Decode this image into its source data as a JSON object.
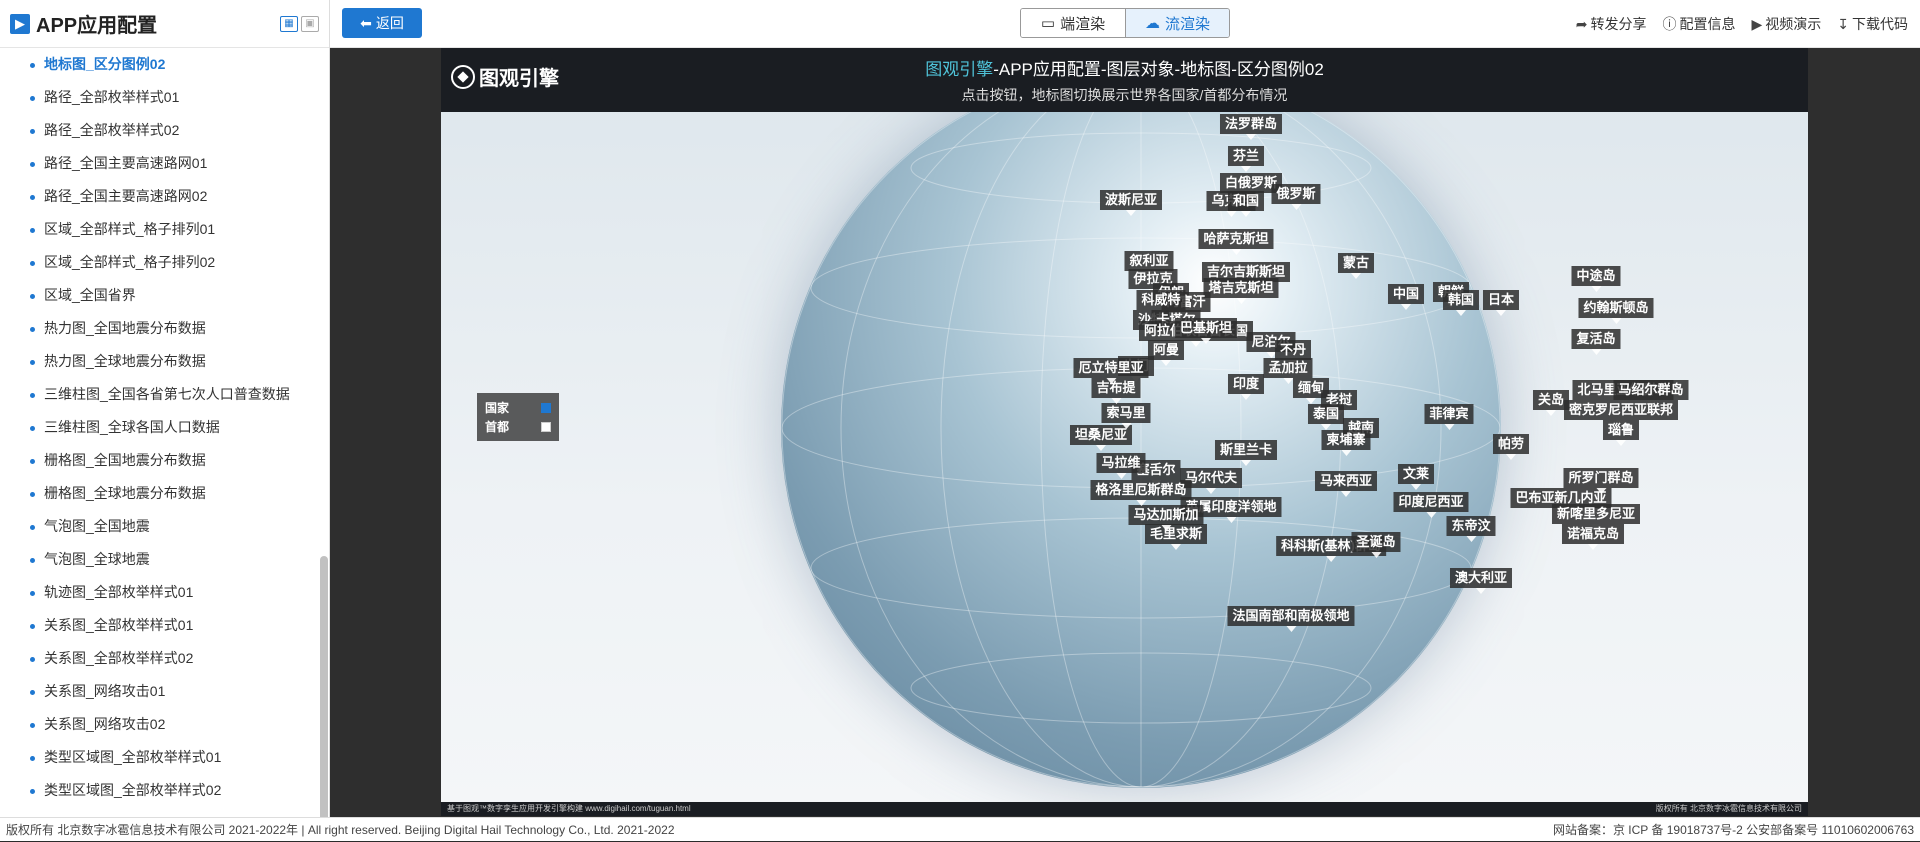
{
  "sidebar": {
    "title": "APP应用配置",
    "icon": "app-config-icon",
    "items": [
      "地标图_区分图例02",
      "路径_全部枚举样式01",
      "路径_全部枚举样式02",
      "路径_全国主要高速路网01",
      "路径_全国主要高速路网02",
      "区域_全部样式_格子排列01",
      "区域_全部样式_格子排列02",
      "区域_全国省界",
      "热力图_全国地震分布数据",
      "热力图_全球地震分布数据",
      "三维柱图_全国各省第七次人口普查数据",
      "三维柱图_全球各国人口数据",
      "栅格图_全国地震分布数据",
      "栅格图_全球地震分布数据",
      "气泡图_全国地震",
      "气泡图_全球地震",
      "轨迹图_全部枚举样式01",
      "关系图_全部枚举样式01",
      "关系图_全部枚举样式02",
      "关系图_网络攻击01",
      "关系图_网络攻击02",
      "类型区域图_全部枚举样式01",
      "类型区域图_全部枚举样式02"
    ]
  },
  "toolbar": {
    "back_label": "返回",
    "end_render": "端渲染",
    "stream_render": "流渲染",
    "actions": [
      "转发分享",
      "配置信息",
      "视频演示",
      "下载代码"
    ]
  },
  "scene": {
    "brand": "图观引擎",
    "title_highlight": "图观引擎",
    "title_rest": "-APP应用配置-图层对象-地标图-区分图例02",
    "subtitle": "点击按钮，地标图切换展示世界各国家/首都分布情况",
    "legend": {
      "country_label": "国家",
      "capital_label": "首都",
      "country_checked": true,
      "capital_checked": false
    },
    "labels": [
      "法罗群岛",
      "芬兰",
      "白俄罗斯",
      "乌克兰",
      "波斯尼亚",
      "和国",
      "俄罗斯",
      "哈萨克斯坦",
      "吉尔吉斯斯坦",
      "塔吉克斯坦",
      "叙利亚",
      "伊拉克",
      "伊朗",
      "阿富汗",
      "科威特",
      "沙特",
      "卡塔尔",
      "阿拉伯联合酋长国",
      "巴基斯坦",
      "阿曼",
      "也门",
      "尼泊尔",
      "不丹",
      "孟加拉",
      "印度",
      "缅甸",
      "老挝",
      "泰国",
      "越南",
      "柬埔寨",
      "中国",
      "蒙古",
      "朝鲜",
      "韩国",
      "日本",
      "中途岛",
      "约翰斯顿岛",
      "复活岛",
      "北马里亚纳群岛",
      "关岛",
      "马绍尔群岛",
      "密克罗尼西亚联邦",
      "瑙鲁",
      "菲律宾",
      "帕劳",
      "斯里兰卡",
      "马尔代夫",
      "英属印度洋领地",
      "马来西亚",
      "文莱",
      "印度尼西亚",
      "巴布亚新几内亚",
      "所罗门群岛",
      "新喀里多尼亚",
      "诺福克岛",
      "东帝汶",
      "澳大利亚",
      "科科斯(基林)群岛",
      "圣诞岛",
      "毛里求斯",
      "马达加斯加",
      "塞舌尔",
      "格洛里厄斯群岛",
      "坦桑尼亚",
      "索马里",
      "吉布提",
      "厄立特里亚",
      "马拉维",
      "法国南部和南极领地"
    ],
    "footer_left": "基于图观™数字孪生应用开发引擎构建 www.digihail.com/tuguan.html",
    "footer_right": "版权所有 北京数字冰雹信息技术有限公司"
  },
  "page_footer": {
    "left": "版权所有 北京数字冰雹信息技术有限公司 2021-2022年 | All right reserved. Beijing Digital Hail Technology Co., Ltd. 2021-2022",
    "right": "网站备案：京 ICP 备 19018737号-2 公安部备案号 11010602006763"
  }
}
